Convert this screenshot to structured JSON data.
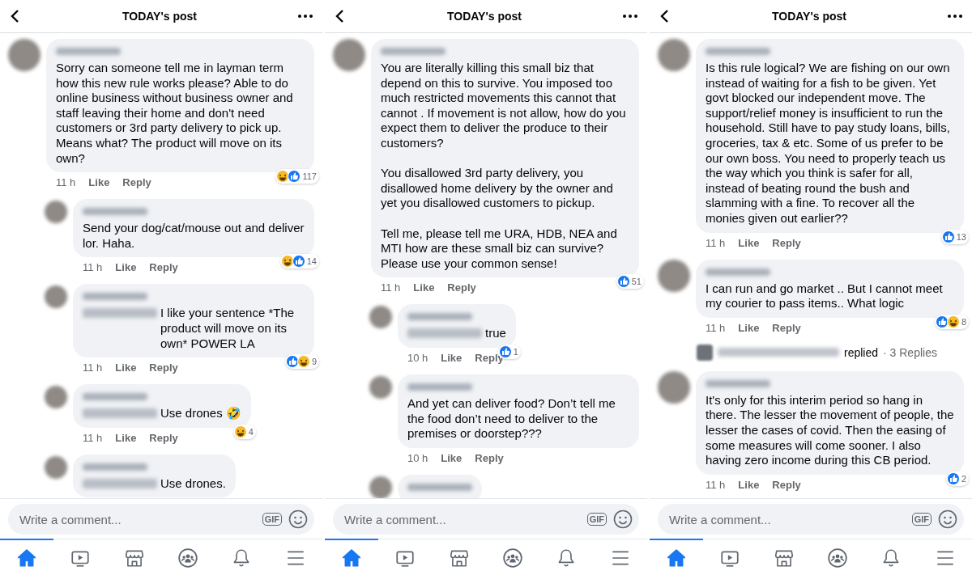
{
  "panels": [
    {
      "header": {
        "title": "TODAY's post"
      },
      "comments": [
        {
          "kind": "comment",
          "mention": false,
          "text": "Sorry can someone tell me in layman term how this new rule works please? Able to do online business without business owner and staff leaving their home and don't need customers or 3rd party delivery to pick up. Means what? The product will move on its own?",
          "actions": {
            "time": "11 h",
            "like": "Like",
            "reply": "Reply"
          },
          "reactions": {
            "items": [
              {
                "kind": "haha"
              },
              {
                "kind": "like"
              }
            ],
            "count": "117"
          }
        },
        {
          "kind": "reply",
          "mention": false,
          "text": "Send your dog/cat/mouse out and deliver lor. Haha.",
          "actions": {
            "time": "11 h",
            "like": "Like",
            "reply": "Reply"
          },
          "reactions": {
            "items": [
              {
                "kind": "haha"
              },
              {
                "kind": "like"
              }
            ],
            "count": "14"
          }
        },
        {
          "kind": "reply",
          "mention": true,
          "text": "I like your sentence *The product will move on its own* POWER LA",
          "actions": {
            "time": "11 h",
            "like": "Like",
            "reply": "Reply"
          },
          "reactions": {
            "items": [
              {
                "kind": "like"
              },
              {
                "kind": "haha"
              }
            ],
            "count": "9"
          }
        },
        {
          "kind": "reply",
          "mention": true,
          "text": "Use drones 🤣",
          "actions": {
            "time": "11 h",
            "like": "Like",
            "reply": "Reply"
          },
          "reactions": {
            "items": [
              {
                "kind": "haha"
              }
            ],
            "count": "4"
          }
        },
        {
          "kind": "reply",
          "mention": true,
          "text": "Use drones."
        }
      ],
      "composer": {
        "placeholder": "Write a comment...",
        "gif": "GIF"
      },
      "nav": [
        {
          "selected": true
        },
        {
          "selected": false
        },
        {
          "selected": false
        },
        {
          "selected": false
        },
        {
          "selected": false
        },
        {
          "selected": false
        }
      ]
    },
    {
      "header": {
        "title": "TODAY's post"
      },
      "comments": [
        {
          "kind": "comment",
          "mention": false,
          "text": "You are literally killing this small biz that depend on this to survive. You imposed too much restricted movements this cannot that cannot .  If movement is not allow, how do you expect them to deliver the produce to their customers?\n\nYou disallowed 3rd party delivery, you disallowed home delivery by the owner and yet you disallowed customers to pickup.\n\nTell me, please tell me URA, HDB, NEA and MTI how are these small biz can survive? Please use your common sense!",
          "actions": {
            "time": "11 h",
            "like": "Like",
            "reply": "Reply"
          },
          "reactions": {
            "items": [
              {
                "kind": "like"
              }
            ],
            "count": "51"
          }
        },
        {
          "kind": "reply",
          "mention": true,
          "text": "true",
          "actions": {
            "time": "10 h",
            "like": "Like",
            "reply": "Reply"
          },
          "reactions": {
            "items": [
              {
                "kind": "like"
              }
            ],
            "count": "1"
          }
        },
        {
          "kind": "reply",
          "mention": false,
          "text": "And yet can deliver food? Don’t tell me the food don’t need to deliver to the premises or doorstep???",
          "actions": {
            "time": "10 h",
            "like": "Like",
            "reply": "Reply"
          }
        },
        {
          "kind": "reply"
        }
      ],
      "composer": {
        "placeholder": "Write a comment...",
        "gif": "GIF"
      },
      "nav": [
        {
          "selected": true
        },
        {
          "selected": false
        },
        {
          "selected": false
        },
        {
          "selected": false
        },
        {
          "selected": false
        },
        {
          "selected": false
        }
      ]
    },
    {
      "header": {
        "title": "TODAY's post"
      },
      "comments": [
        {
          "kind": "comment",
          "mention": false,
          "text": "Is this rule logical? We are fishing on our own instead of waiting for a fish to be given. Yet govt blocked our independent move. The support/relief money is insufficient to run the household. Still have to pay study loans, bills, groceries, tax & etc. Some of us prefer to be our own boss. You need to properly teach us the way which you think is safer for all, instead of beating round the bush and slamming with a fine. To recover all the monies given out earlier??",
          "actions": {
            "time": "11 h",
            "like": "Like",
            "reply": "Reply"
          },
          "reactions": {
            "items": [
              {
                "kind": "like"
              }
            ],
            "count": "13"
          }
        },
        {
          "kind": "comment",
          "mention": false,
          "text": "I can run and go market .. But I cannot meet my courier to pass items.. What logic",
          "actions": {
            "time": "11 h",
            "like": "Like",
            "reply": "Reply"
          },
          "reactions": {
            "items": [
              {
                "kind": "like"
              },
              {
                "kind": "haha"
              }
            ],
            "count": "8"
          }
        },
        {
          "kind": "replies-summary",
          "text": "replied",
          "count": "· 3 Replies"
        },
        {
          "kind": "comment",
          "mention": false,
          "text": "It's only for this interim period so hang in there. The lesser the movement of people, the lesser the cases of covid. Then the easing of some measures will come sooner. I also having zero income during this CB period.",
          "actions": {
            "time": "11 h",
            "like": "Like",
            "reply": "Reply"
          },
          "reactions": {
            "items": [
              {
                "kind": "like"
              }
            ],
            "count": "2"
          }
        }
      ],
      "composer": {
        "placeholder": "Write a comment...",
        "gif": "GIF"
      },
      "nav": [
        {
          "selected": true
        },
        {
          "selected": false
        },
        {
          "selected": false
        },
        {
          "selected": false
        },
        {
          "selected": false
        },
        {
          "selected": false
        }
      ]
    }
  ]
}
